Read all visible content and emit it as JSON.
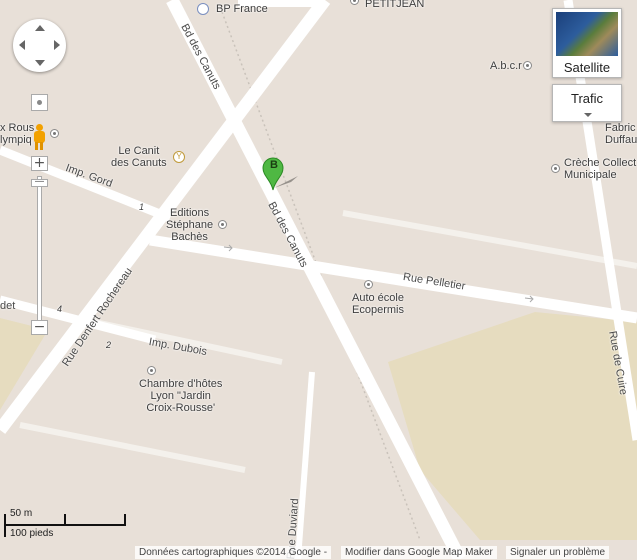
{
  "map": {
    "roads": {
      "bd_canuts_1": "Bd des Canuts",
      "bd_canuts_2": "Bd des Canuts",
      "imp_gord": "Imp. Gord",
      "rue_pelletier": "Rue Pelletier",
      "rue_denfert": "Rue Denfert Rochereau",
      "imp_dubois": "Imp. Dubois",
      "rue_duviard": "Rue Duviard",
      "rue_cuire": "Rue de Cuire",
      "det": "det"
    },
    "pois": {
      "bp_france": "BP France",
      "petit_jean": "PETITJEAN",
      "abcr": "A.b.c.r",
      "le_canit_1": "Le Canit",
      "le_canit_2": "des Canuts",
      "editions_1": "Editions",
      "editions_2": "Stéphane",
      "editions_3": "Bachès",
      "fabric_1": "Fabric",
      "fabric_2": "Duffau",
      "creche_1": "Crèche Collect",
      "creche_2": "Municipale",
      "auto_1": "Auto école",
      "auto_2": "Ecopermis",
      "chambre_1": "Chambre d'hôtes",
      "chambre_2": "Lyon \"Jardin",
      "chambre_3": "Croix-Rousse'",
      "olympic_1": "x Rous",
      "olympic_2": "lympiq"
    },
    "house_numbers": {
      "n1": "1",
      "n2": "2",
      "n4": "4"
    },
    "marker_label": "B",
    "controls": {
      "zoom_in": "+",
      "zoom_out": "−",
      "satellite_label": "Satellite",
      "traffic_label": "Trafic"
    },
    "scale": {
      "metric": "50 m",
      "imperial": "100 pieds"
    },
    "attribution": {
      "data": "Données cartographiques ©2014 Google -",
      "edit": "Modifier dans Google Map Maker",
      "report": "Signaler un problème"
    },
    "colors": {
      "land": "#e8e0d8",
      "park": "#e6dcc0",
      "road": "#ffffff",
      "marker": "#4fb843"
    }
  }
}
